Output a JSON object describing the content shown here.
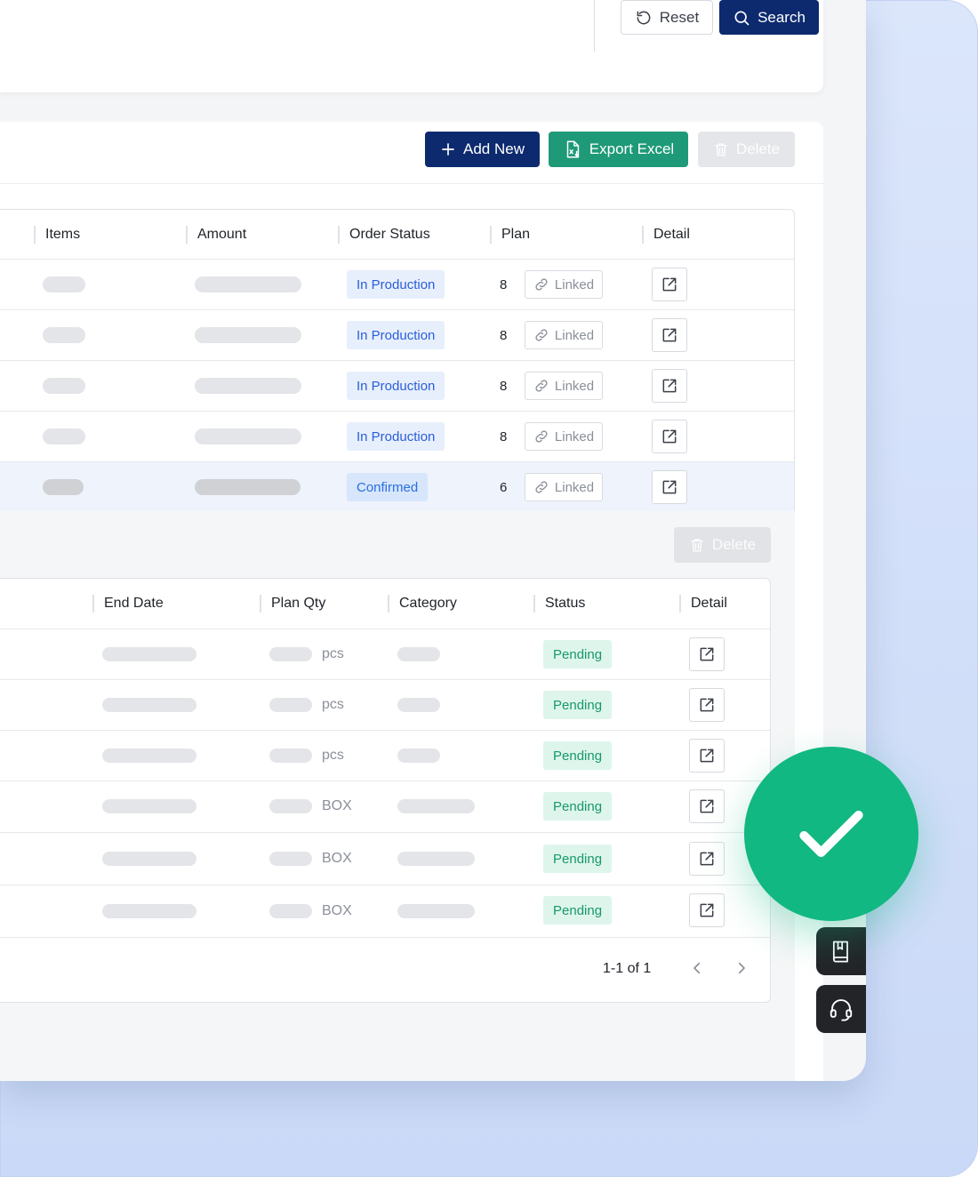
{
  "colors": {
    "primary": "#0d2a6e",
    "export": "#1f9a78",
    "success": "#11b881",
    "tag_blue_text": "#2a5ed8",
    "tag_green_text": "#17996a"
  },
  "filter": {
    "reset_label": "Reset",
    "search_label": "Search"
  },
  "toolbar": {
    "add_label": "Add New",
    "export_label": "Export Excel",
    "delete_label": "Delete"
  },
  "orders_table": {
    "columns": [
      "Items",
      "Amount",
      "Order Status",
      "Plan",
      "Detail"
    ],
    "rows": [
      {
        "status": "In Production",
        "plan": "8",
        "linked": "Linked",
        "selected": false
      },
      {
        "status": "In Production",
        "plan": "8",
        "linked": "Linked",
        "selected": false
      },
      {
        "status": "In Production",
        "plan": "8",
        "linked": "Linked",
        "selected": false
      },
      {
        "status": "In Production",
        "plan": "8",
        "linked": "Linked",
        "selected": false
      },
      {
        "status": "Confirmed",
        "plan": "6",
        "linked": "Linked",
        "selected": true
      }
    ]
  },
  "plan_section": {
    "delete_label": "Delete",
    "columns": [
      "End Date",
      "Plan Qty",
      "Category",
      "Status",
      "Detail"
    ],
    "rows": [
      {
        "unit": "pcs",
        "status": "Pending"
      },
      {
        "unit": "pcs",
        "status": "Pending"
      },
      {
        "unit": "pcs",
        "status": "Pending"
      },
      {
        "unit": "BOX",
        "status": "Pending"
      },
      {
        "unit": "BOX",
        "status": "Pending"
      },
      {
        "unit": "BOX",
        "status": "Pending"
      }
    ],
    "pagination": "1-1 of 1"
  },
  "icons": {
    "reset": "reset-icon",
    "search": "search-icon",
    "add": "plus-icon",
    "export": "excel-file-icon",
    "delete": "trash-icon",
    "link": "link-icon",
    "detail": "external-link-icon",
    "prev": "chevron-left-icon",
    "next": "chevron-right-icon",
    "manual": "book-icon",
    "support": "headset-icon",
    "success": "checkmark-icon"
  }
}
